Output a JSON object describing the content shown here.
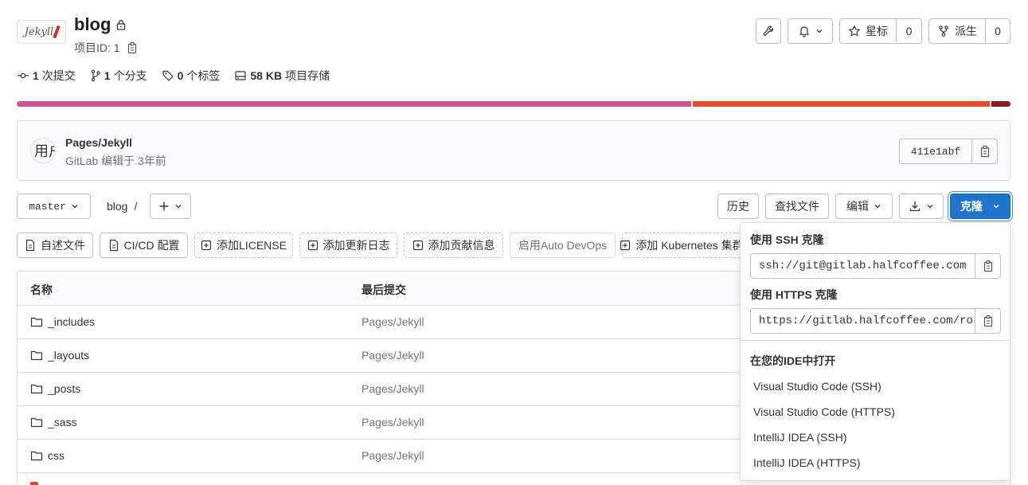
{
  "project": {
    "avatar_text": "Jekyll",
    "name": "blog",
    "id_label": "项目ID: 1"
  },
  "header_actions": {
    "star_label": "星标",
    "star_count": "0",
    "fork_label": "派生",
    "fork_count": "0"
  },
  "stats": [
    {
      "num": "1",
      "label": "次提交",
      "icon": "commit-icon"
    },
    {
      "num": "1",
      "label": "个分支",
      "icon": "branch-icon"
    },
    {
      "num": "0",
      "label": "个标签",
      "icon": "tag-icon"
    },
    {
      "num": "58 KB",
      "label": "项目存储",
      "icon": "storage-icon"
    }
  ],
  "languages": [
    {
      "share": 0.681,
      "color": "#cc5590"
    },
    {
      "share": 0.3,
      "color": "#e44d26"
    },
    {
      "share": 0.019,
      "color": "#8b1a1a"
    }
  ],
  "last_commit": {
    "avatar_text": "用户",
    "title": "Pages/Jekyll",
    "meta": "GitLab 编辑于 3年前",
    "sha": "411e1abf"
  },
  "toolbar": {
    "branch": "master",
    "path": "blog",
    "path_sep": "/",
    "history": "历史",
    "find_file": "查找文件",
    "edit": "编辑",
    "clone": "克隆"
  },
  "shortcuts": [
    {
      "label": "自述文件",
      "style": "solid",
      "icon": "file-icon"
    },
    {
      "label": "CI/CD 配置",
      "style": "solid",
      "icon": "file-icon"
    },
    {
      "label": "添加LICENSE",
      "style": "dashed",
      "icon": "plus-square-icon"
    },
    {
      "label": "添加更新日志",
      "style": "dashed",
      "icon": "plus-square-icon"
    },
    {
      "label": "添加贡献信息",
      "style": "dashed",
      "icon": "plus-square-icon"
    },
    {
      "label": "启用Auto DevOps",
      "style": "muted",
      "icon": ""
    },
    {
      "label": "添加 Kubernetes 集群",
      "style": "dashed",
      "icon": "plus-square-icon"
    }
  ],
  "table": {
    "col_name": "名称",
    "col_commit": "最后提交",
    "rows": [
      {
        "name": "_includes",
        "commit": "Pages/Jekyll"
      },
      {
        "name": "_layouts",
        "commit": "Pages/Jekyll"
      },
      {
        "name": "_posts",
        "commit": "Pages/Jekyll"
      },
      {
        "name": "_sass",
        "commit": "Pages/Jekyll"
      },
      {
        "name": "css",
        "commit": "Pages/Jekyll"
      }
    ]
  },
  "clone_dropdown": {
    "ssh_label": "使用 SSH 克隆",
    "ssh_url": "ssh://git@gitlab.halfcoffee.com",
    "https_label": "使用 HTTPS 克隆",
    "https_url": "https://gitlab.halfcoffee.com/ro",
    "ide_label": "在您的IDE中打开",
    "ide_items": [
      "Visual Studio Code (SSH)",
      "Visual Studio Code (HTTPS)",
      "IntelliJ IDEA (SSH)",
      "IntelliJ IDEA (HTTPS)"
    ]
  },
  "colors": {
    "primary": "#1f75cb",
    "border": "#dcdcde"
  }
}
